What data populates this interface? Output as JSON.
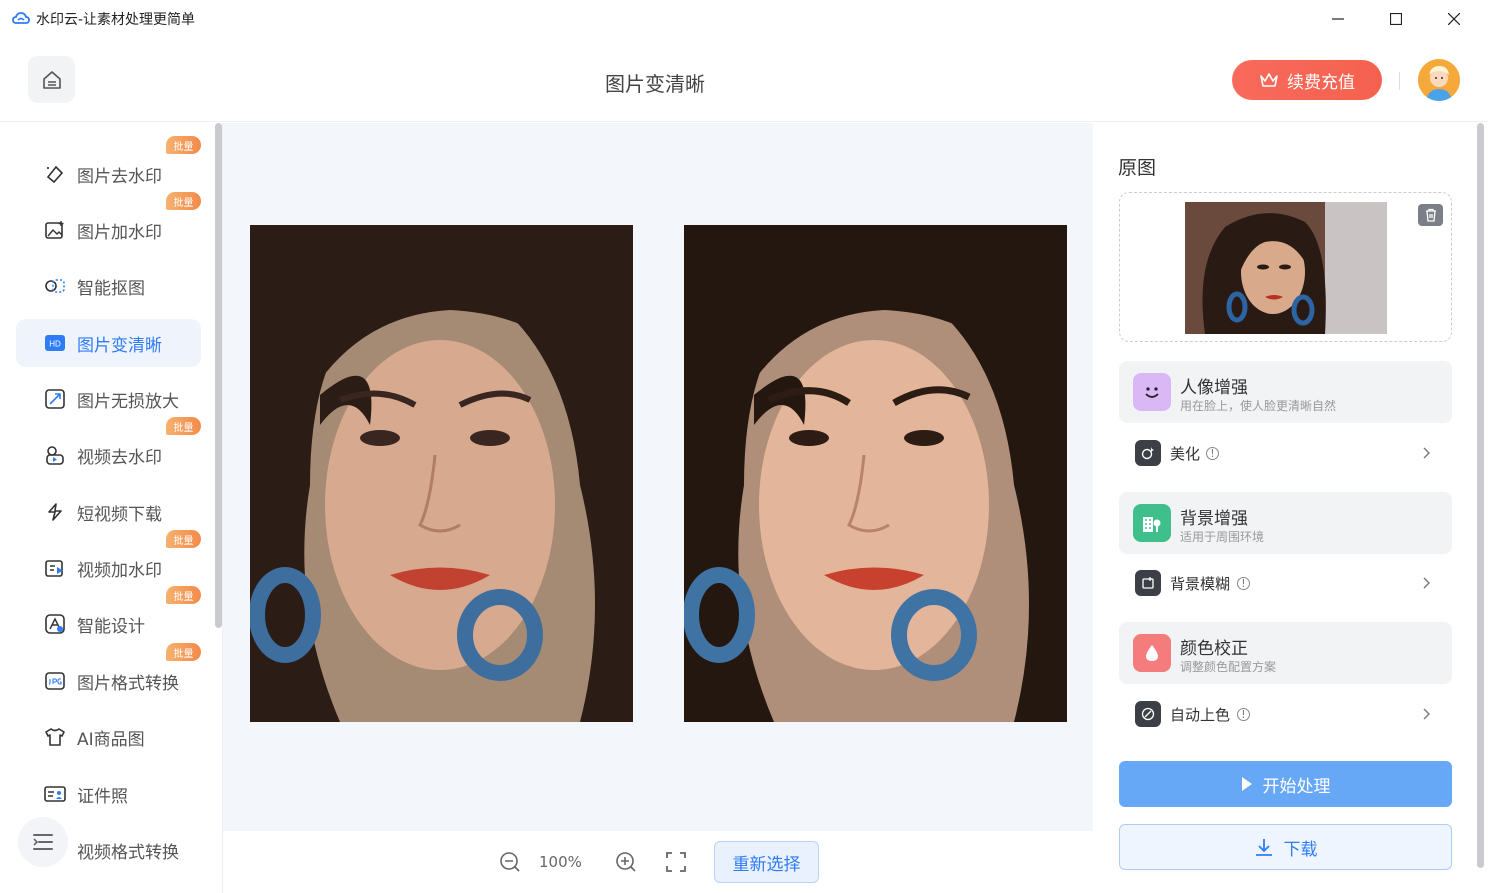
{
  "window": {
    "title": "水印云-让素材处理更简单"
  },
  "header": {
    "page_title": "图片变清晰",
    "vip_label": "续费充值"
  },
  "sidebar": {
    "items": [
      {
        "label": "图片去水印",
        "icon": "eraser-icon",
        "badge": "批量"
      },
      {
        "label": "图片加水印",
        "icon": "image-add-icon",
        "badge": "批量"
      },
      {
        "label": "智能抠图",
        "icon": "cutout-icon",
        "badge": ""
      },
      {
        "label": "图片变清晰",
        "icon": "hd-icon",
        "badge": "",
        "active": true
      },
      {
        "label": "图片无损放大",
        "icon": "expand-icon",
        "badge": ""
      },
      {
        "label": "视频去水印",
        "icon": "video-eraser-icon",
        "badge": "批量"
      },
      {
        "label": "短视频下载",
        "icon": "download-link-icon",
        "badge": ""
      },
      {
        "label": "视频加水印",
        "icon": "video-add-icon",
        "badge": "批量"
      },
      {
        "label": "智能设计",
        "icon": "design-icon",
        "badge": "批量"
      },
      {
        "label": "图片格式转换",
        "icon": "jpg-icon",
        "badge": "批量"
      },
      {
        "label": "AI商品图",
        "icon": "shirt-icon",
        "badge": ""
      },
      {
        "label": "证件照",
        "icon": "id-card-icon",
        "badge": ""
      },
      {
        "label": "视频格式转换",
        "icon": "video-convert-icon",
        "badge": ""
      }
    ],
    "hd_icon_text": "HD"
  },
  "toolbar": {
    "zoom": "100%",
    "reselect_label": "重新选择"
  },
  "panel": {
    "title": "原图",
    "features": [
      {
        "name": "人像增强",
        "desc": "用在脸上，使人脸更清晰自然",
        "option": "美化",
        "color": "#d9b8f5"
      },
      {
        "name": "背景增强",
        "desc": "适用于周围环境",
        "option": "背景模糊",
        "color": "#3fbf8c"
      },
      {
        "name": "颜色校正",
        "desc": "调整颜色配置方案",
        "option": "自动上色",
        "color": "#f47c7c"
      }
    ],
    "start_label": "开始处理",
    "download_label": "下载"
  }
}
